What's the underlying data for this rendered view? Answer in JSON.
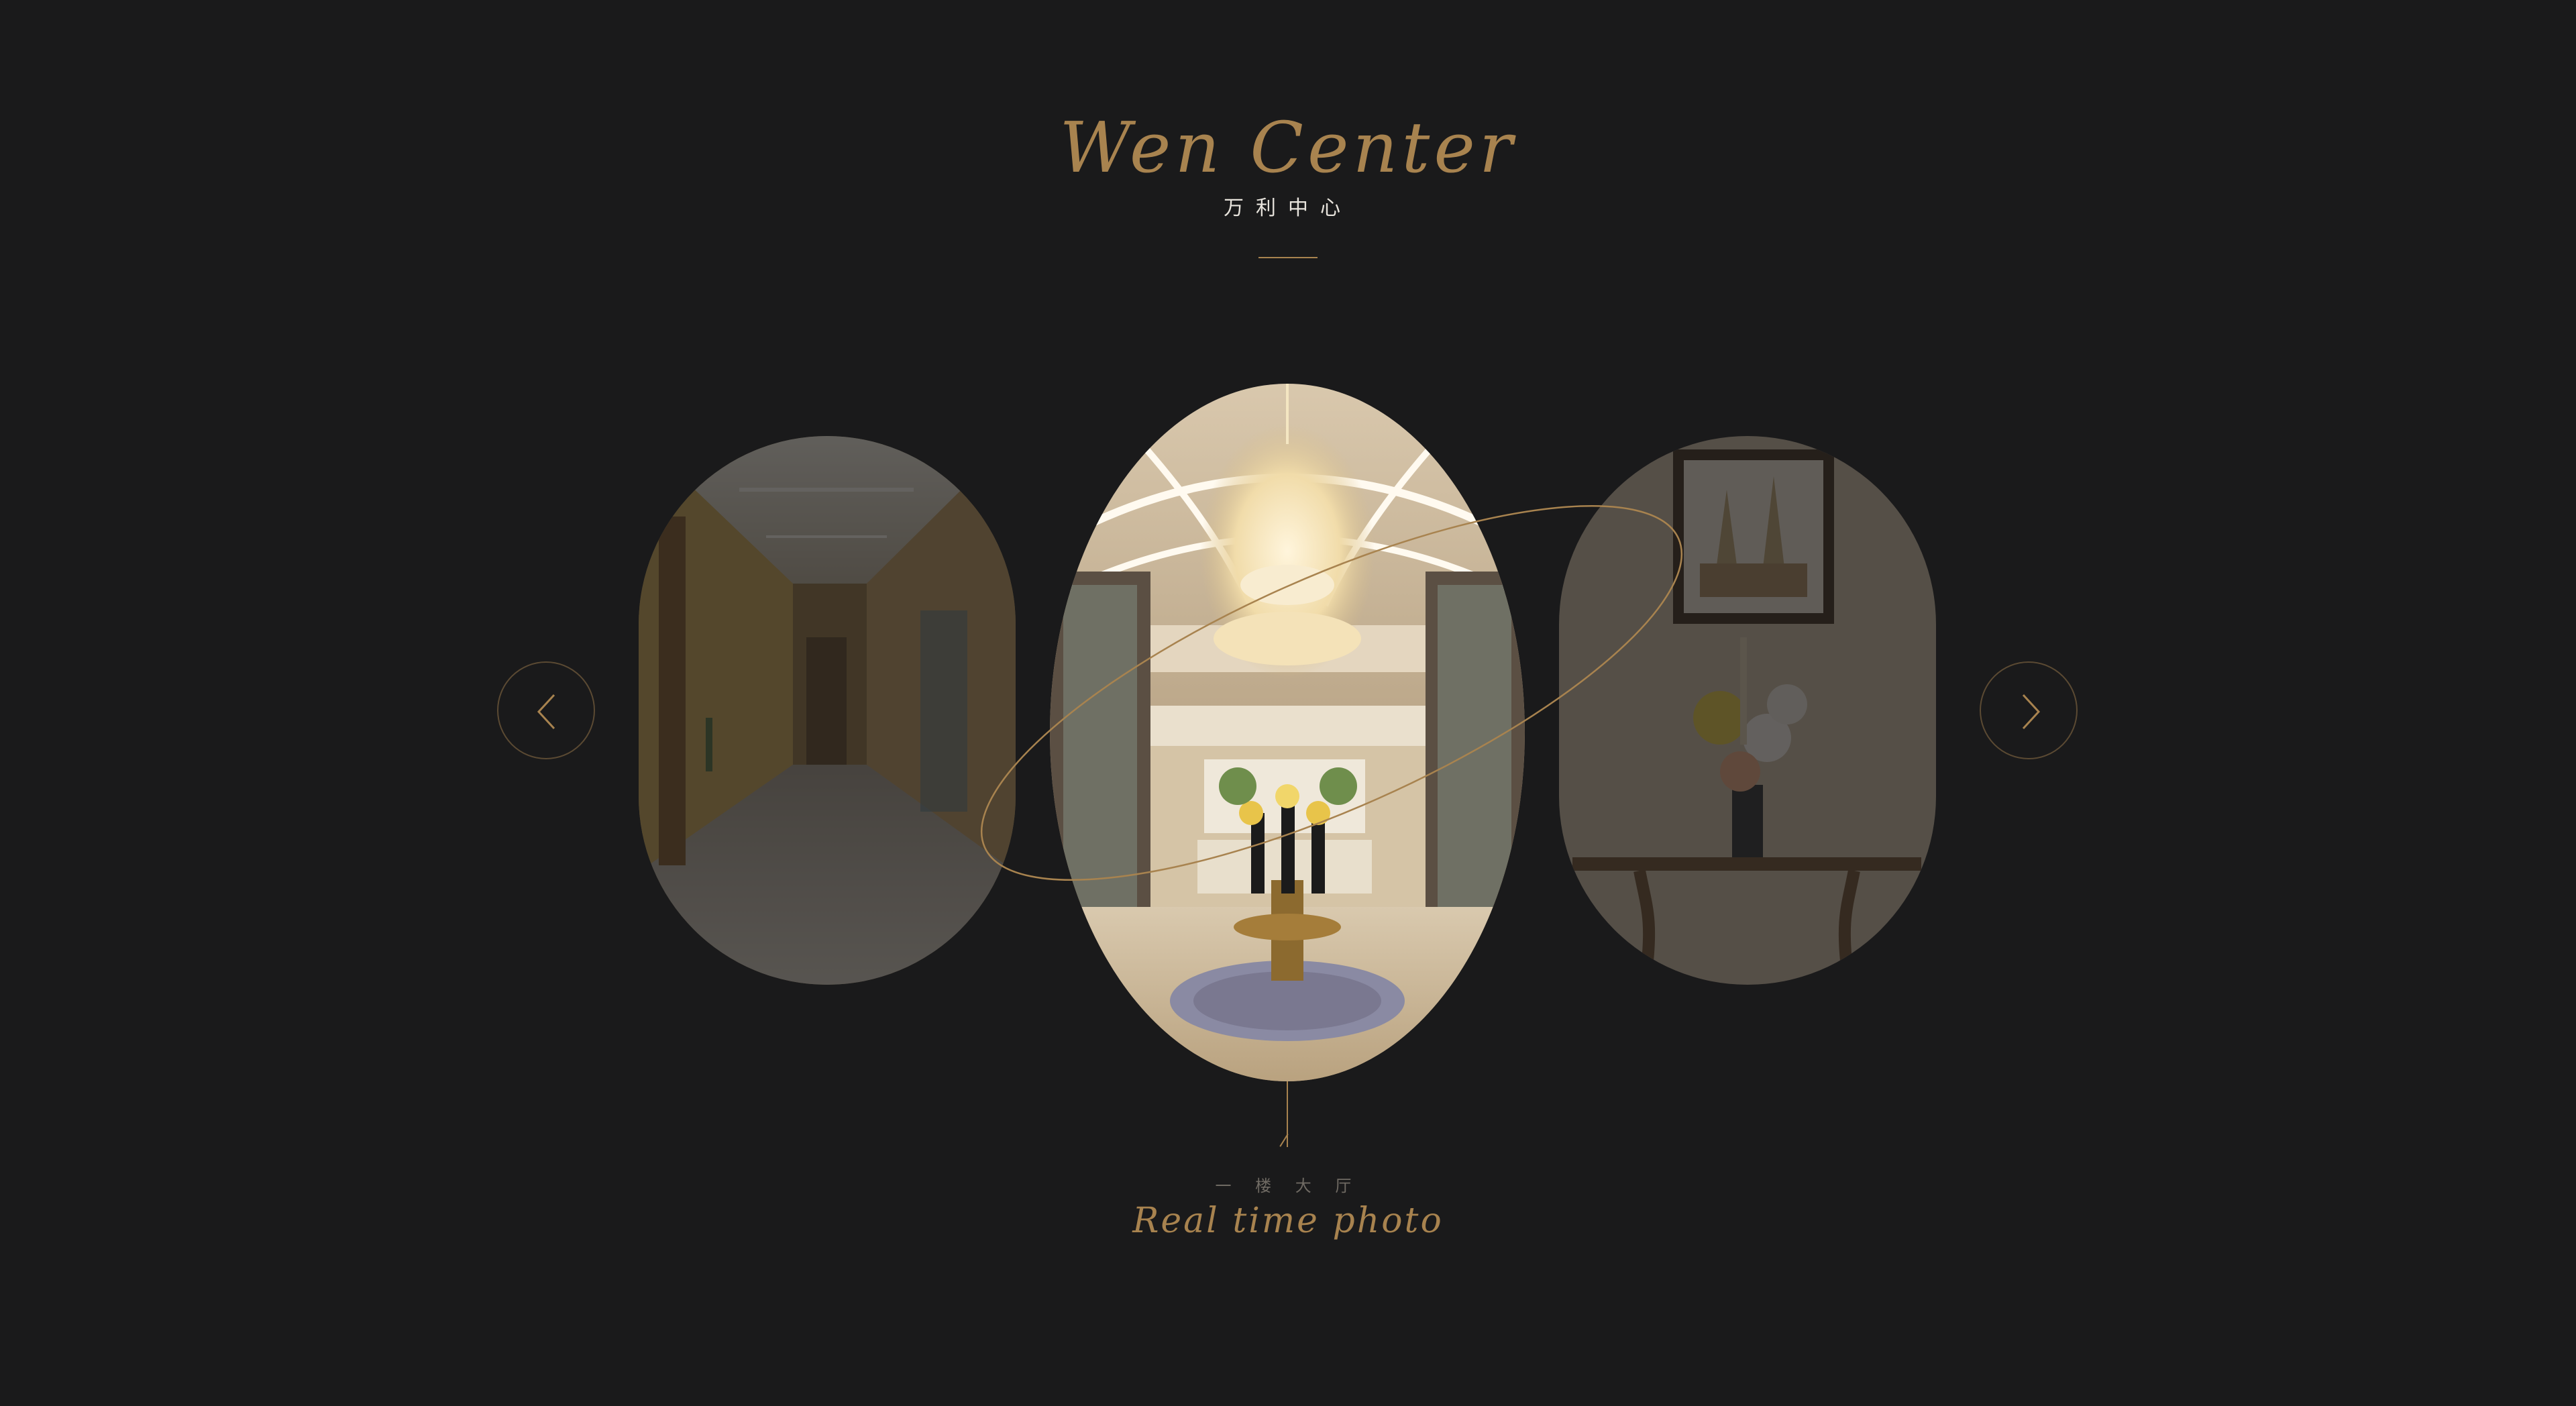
{
  "header": {
    "title": "Wen Center",
    "subtitle": "万利中心"
  },
  "slider": {
    "prev_icon": "chevron-left-icon",
    "next_icon": "chevron-right-icon",
    "slides": [
      {
        "scene": "hotel-corridor"
      },
      {
        "scene": "grand-lobby-chandelier"
      },
      {
        "scene": "console-flower-vase"
      }
    ],
    "caption": {
      "location": "一 楼 大 厅",
      "tagline": "Real time photo"
    }
  },
  "colors": {
    "background": "#1a1a1b",
    "accent_gold": "#a8834f",
    "subtitle_text": "#e7e3dc"
  }
}
